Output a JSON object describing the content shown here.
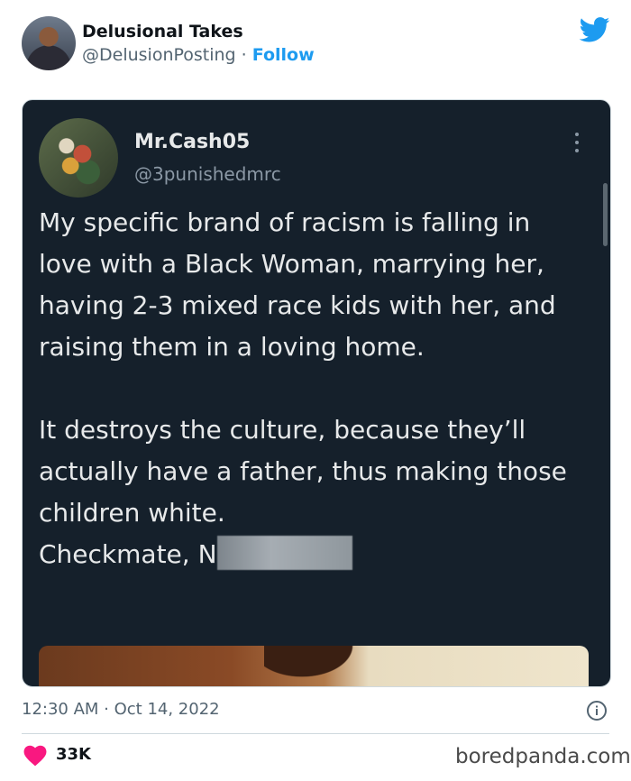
{
  "header": {
    "author_name": "Delusional Takes",
    "author_handle": "@DelusionPosting",
    "separator": "·",
    "follow_label": "Follow"
  },
  "embedded_tweet": {
    "name": "Mr.Cash05",
    "handle": "@3punishedmrc",
    "paragraph_1": "My specific brand of racism is falling in love with a Black Woman, marrying her, having 2-3 mixed race kids with her, and raising them in a loving home.",
    "paragraph_2": "It destroys the culture, because they’ll actually have a father, thus making those children white.",
    "paragraph_3": "Checkmate, N"
  },
  "footer": {
    "timestamp": "12:30 AM · Oct 14, 2022",
    "likes": "33K",
    "watermark": "boredpanda.com"
  },
  "colors": {
    "accent": "#1d9bf0",
    "like": "#f91880",
    "embed_bg": "#15202b"
  },
  "icons": [
    "twitter-bird-icon",
    "more-options-icon",
    "info-icon",
    "heart-icon"
  ]
}
